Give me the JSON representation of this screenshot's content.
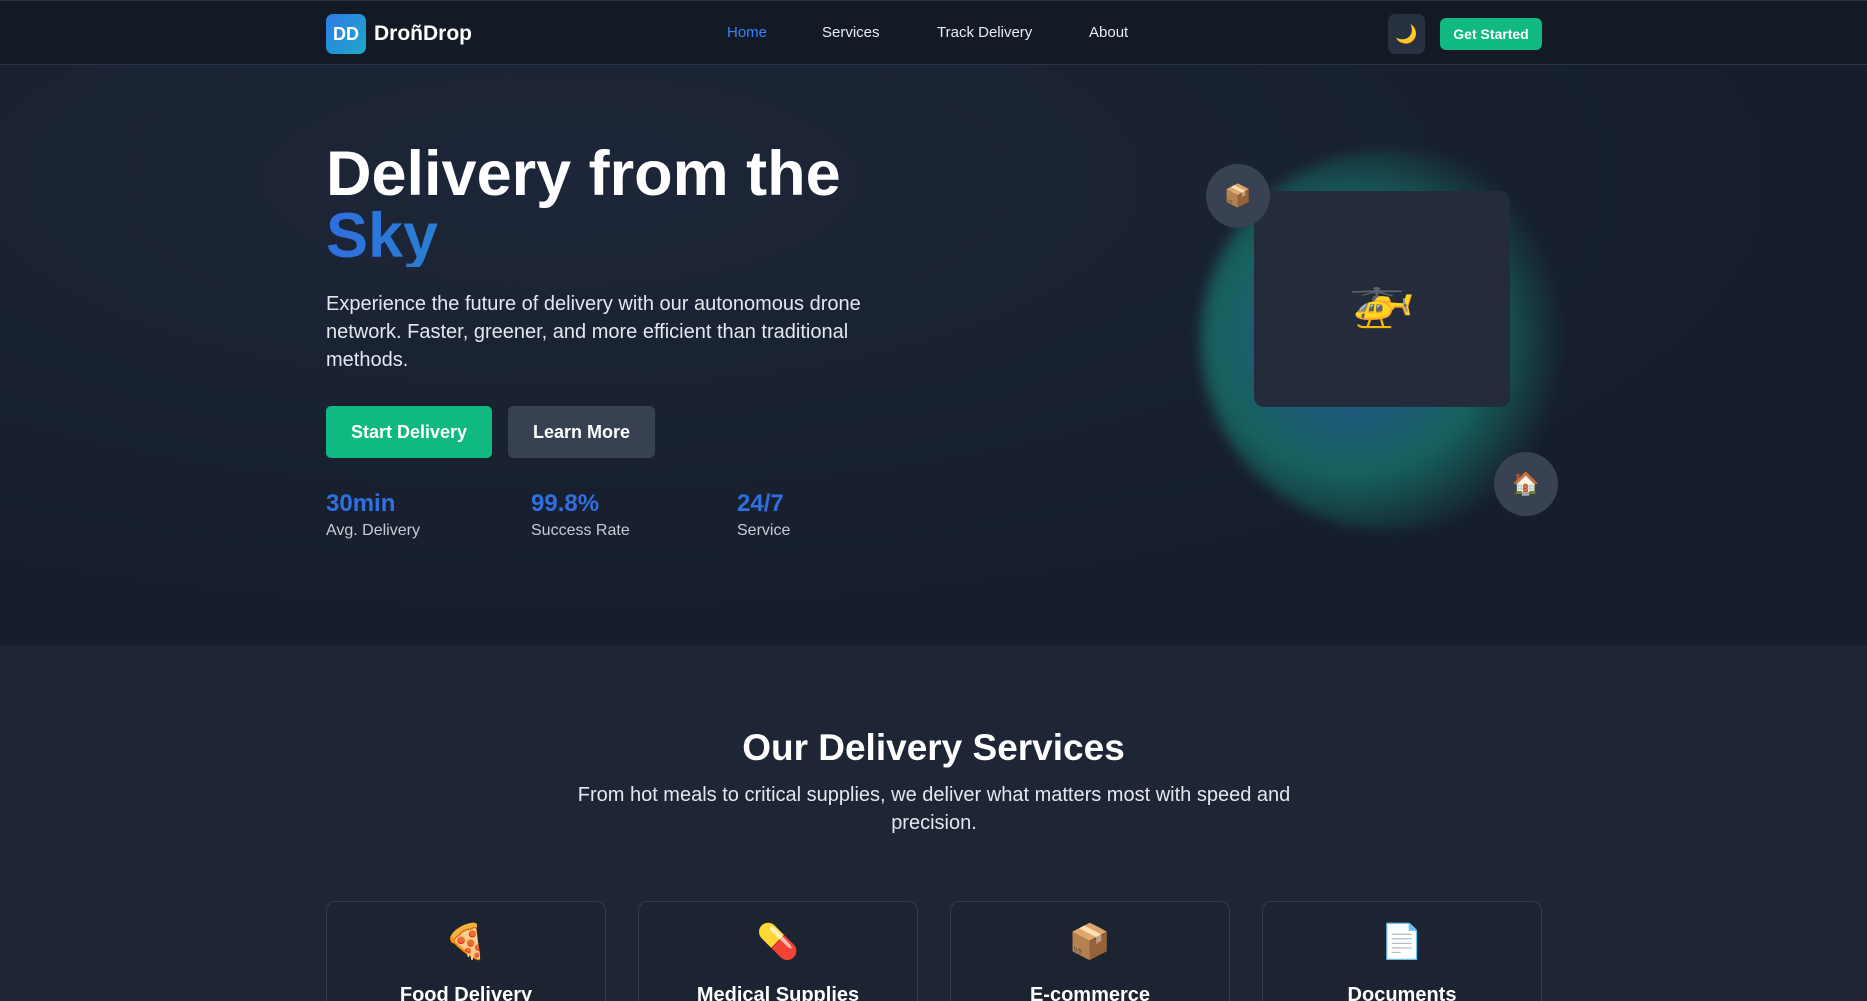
{
  "nav": {
    "logo_badge": "DD",
    "logo_text": "DroñDrop",
    "links": [
      "Home",
      "Services",
      "Track Delivery",
      "About"
    ],
    "active_link": "Home",
    "theme_icon": "🌙",
    "cta": "Get Started"
  },
  "hero": {
    "title_line1": "Delivery from the",
    "title_line2": "Sky",
    "description": "Experience the future of delivery with our autonomous drone network. Faster, greener, and more efficient than traditional methods.",
    "primary_button": "Start Delivery",
    "secondary_button": "Learn More",
    "stats": [
      {
        "value": "30min",
        "label": "Avg. Delivery"
      },
      {
        "value": "99.8%",
        "label": "Success Rate"
      },
      {
        "value": "24/7",
        "label": "Service"
      }
    ],
    "drone_icon": "🚁",
    "package_icon": "📦",
    "home_icon": "🏠"
  },
  "services": {
    "title": "Our Delivery Services",
    "subtitle": "From hot meals to critical supplies, we deliver what matters most with speed and precision.",
    "cards": [
      {
        "icon": "🍕",
        "title": "Food Delivery"
      },
      {
        "icon": "💊",
        "title": "Medical Supplies"
      },
      {
        "icon": "📦",
        "title": "E-commerce"
      },
      {
        "icon": "📄",
        "title": "Documents"
      }
    ]
  },
  "colors": {
    "accent_blue": "#2f6fe0",
    "accent_green": "#10b981",
    "background": "#1e2636"
  }
}
